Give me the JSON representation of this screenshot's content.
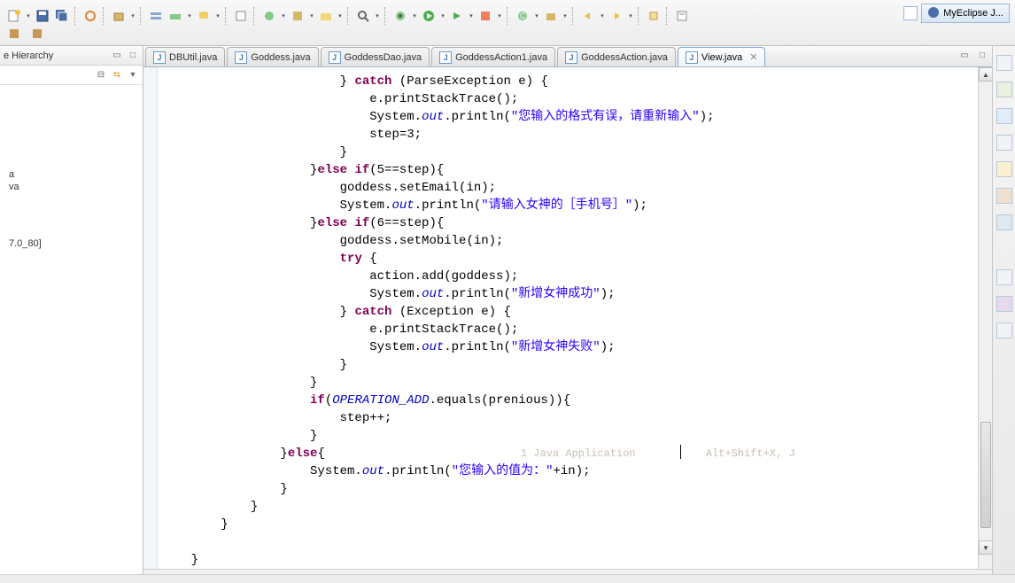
{
  "perspective": {
    "label": "MyEclipse J..."
  },
  "sidebar": {
    "title": "e Hierarchy",
    "items": [
      "a",
      "va",
      "7.0_80]"
    ]
  },
  "tabs": [
    {
      "label": "DBUtil.java"
    },
    {
      "label": "Goddess.java"
    },
    {
      "label": "GoddessDao.java"
    },
    {
      "label": "GoddessAction1.java"
    },
    {
      "label": "GoddessAction.java"
    },
    {
      "label": "View.java",
      "active": true
    }
  ],
  "ghost": {
    "text": "1 Java Application           Alt+Shift+X, J"
  },
  "code": {
    "l1a": "                        } ",
    "l1b": "catch",
    "l1c": " (ParseException e) {",
    "l2": "                            e.printStackTrace();",
    "l3a": "                            System.",
    "l3b": "out",
    "l3c": ".println(",
    "l3d": "\"您输入的格式有误，请重新输入\"",
    "l3e": ");",
    "l4": "                            step=3;",
    "l5": "                        }",
    "l6a": "                    }",
    "l6b": "else if",
    "l6c": "(5==step){",
    "l7": "                        goddess.setEmail(in);",
    "l8a": "                        System.",
    "l8b": "out",
    "l8c": ".println(",
    "l8d": "\"请输入女神的［手机号］\"",
    "l8e": ");",
    "l9a": "                    }",
    "l9b": "else if",
    "l9c": "(6==step){",
    "l10": "                        goddess.setMobile(in);",
    "l11a": "                        ",
    "l11b": "try",
    "l11c": " {",
    "l12": "                            action.add(goddess);",
    "l13a": "                            System.",
    "l13b": "out",
    "l13c": ".println(",
    "l13d": "\"新增女神成功\"",
    "l13e": ");",
    "l14a": "                        } ",
    "l14b": "catch",
    "l14c": " (Exception e) {",
    "l15": "                            e.printStackTrace();",
    "l16a": "                            System.",
    "l16b": "out",
    "l16c": ".println(",
    "l16d": "\"新增女神失败\"",
    "l16e": ");",
    "l17": "                        }",
    "l18": "                    }",
    "l19a": "                    ",
    "l19b": "if",
    "l19c": "(",
    "l19d": "OPERATION_ADD",
    "l19e": ".equals(prenious)){",
    "l20": "                        step++;",
    "l21": "                    }",
    "l22a": "                }",
    "l22b": "else",
    "l22c": "{",
    "l23a": "                    System.",
    "l23b": "out",
    "l23c": ".println(",
    "l23d": "\"您输入的值为：\"",
    "l23e": "+in);",
    "l24": "                }",
    "l25": "            }",
    "l26": "        }",
    "l27": "",
    "l28": "    }"
  }
}
